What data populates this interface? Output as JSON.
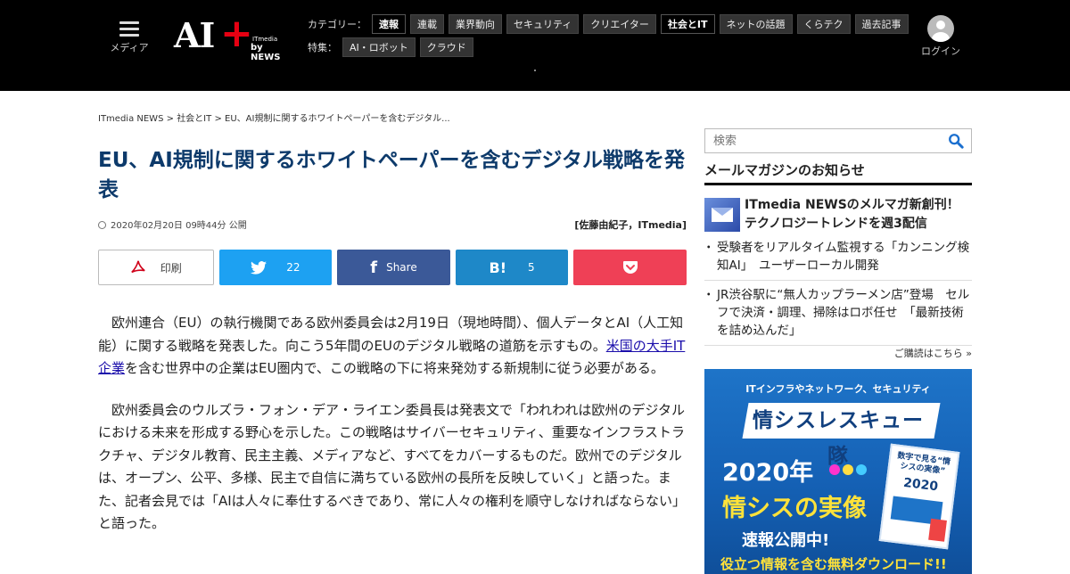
{
  "header": {
    "menu_label": "メディア",
    "logo": {
      "text": "AI",
      "plus": "+",
      "itmedia": "ITmedia",
      "by": "by NEWS"
    },
    "category_label": "カテゴリー：",
    "categories": [
      {
        "label": "速報",
        "active": true
      },
      {
        "label": "連載",
        "active": false
      },
      {
        "label": "業界動向",
        "active": false
      },
      {
        "label": "セキュリティ",
        "active": false
      },
      {
        "label": "クリエイター",
        "active": false
      },
      {
        "label": "社会とIT",
        "active": true
      },
      {
        "label": "ネットの話題",
        "active": false
      },
      {
        "label": "くらテク",
        "active": false
      },
      {
        "label": "過去記事",
        "active": false
      }
    ],
    "feature_label": "特集：",
    "features": [
      {
        "label": "AI・ロボット"
      },
      {
        "label": "クラウド"
      }
    ],
    "login_label": "ログイン"
  },
  "article": {
    "breadcrumb": [
      "ITmedia NEWS",
      "社会とIT",
      "EU、AI規制に関するホワイトペーパーを含むデジタル..."
    ],
    "breadcrumb_sep": ">",
    "title": "EU、AI規制に関するホワイトペーパーを含むデジタル戦略を発表",
    "date": "2020年02月20日 09時44分 公開",
    "author": "[佐藤由紀子，ITmedia]",
    "share": {
      "print": "印刷",
      "twitter_count": "22",
      "facebook": "Share",
      "hatena_icon": "B!",
      "hatena_count": "5"
    },
    "paragraphs": [
      {
        "before": "欧州連合（EU）の執行機関である欧州委員会は2月19日（現地時間）、個人データとAI（人工知能）に関する戦略を発表した。向こう5年間のEUのデジタル戦略の道筋を示すもの。",
        "link": "米国の大手IT企業",
        "after": "を含む世界中の企業はEU圏内で、この戦略の下に将来発効する新規制に従う必要がある。"
      },
      {
        "before": "欧州委員会のウルズラ・フォン・デア・ライエン委員長は発表文で「われわれは欧州のデジタルにおける未来を形成する野心を示した。この戦略はサイバーセキュリティ、重要なインフラストラクチャ、デジタル教育、民主主義、メディアなど、すべてをカバーするものだ。欧州でのデジタルは、オープン、公平、多様、民主で自信に満ちている欧州の長所を反映していく」と語った。また、記者会見では「AIは人々に奉仕するべきであり、常に人々の権利を順守しなければならない」と語った。",
        "link": "",
        "after": ""
      }
    ]
  },
  "sidebar": {
    "search_placeholder": "検索",
    "mailmag_heading": "メールマガジンのお知らせ",
    "feature_text": "ITmedia NEWSのメルマガ新創刊！ テクノロジートレンドを週3配信",
    "list": [
      "受験者をリアルタイム監視する「カンニング検知AI」　ユーザーローカル開発",
      "JR渋谷駅に“無人カップラーメン店”登場　セルフで決済・調理、掃除はロボ任せ　「最新技術を詰め込んだ」"
    ],
    "subscribe_link": "ご購読はこちら »",
    "ad": {
      "line1": "ITインフラやネットワーク、セキュリティ",
      "line2": "情シスレスキュー隊",
      "line3": "2020年",
      "line4": "情シスの実像",
      "line5": "速報公開中!",
      "line6": "役立つ情報を含む無料ダウンロード!!",
      "book_title": "数字で見る“情シスの実像”",
      "book_year": "2020"
    }
  },
  "colors": {
    "header_bg": "#000000",
    "title_color": "#0d3a6b",
    "twitter": "#1da1f2",
    "facebook": "#3b5998",
    "hatena": "#1e88c8",
    "pocket": "#ef4056",
    "logo_plus": "#e60012",
    "link": "#1a0dab"
  }
}
